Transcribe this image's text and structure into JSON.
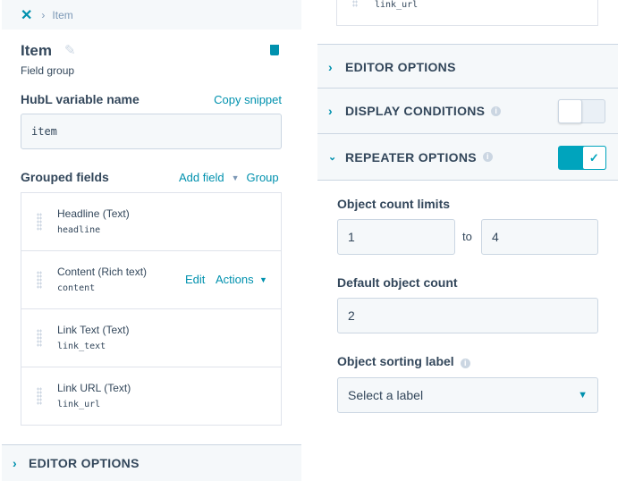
{
  "breadcrumb": {
    "current": "Item"
  },
  "header": {
    "title": "Item",
    "subtitle": "Field group"
  },
  "hubl": {
    "label": "HubL variable name",
    "copy": "Copy snippet",
    "value": "item"
  },
  "grouped": {
    "label": "Grouped fields",
    "add": "Add field",
    "group": "Group",
    "fields": [
      {
        "name": "Headline (Text)",
        "key": "headline"
      },
      {
        "name": "Content (Rich text)",
        "key": "content",
        "edit": "Edit",
        "actions": "Actions"
      },
      {
        "name": "Link Text (Text)",
        "key": "link_text"
      },
      {
        "name": "Link URL (Text)",
        "key": "link_url"
      }
    ]
  },
  "left_editor": "EDITOR OPTIONS",
  "right": {
    "top_key": "link_url",
    "editor": "EDITOR OPTIONS",
    "display": "DISPLAY CONDITIONS",
    "display_on": false,
    "repeater": "REPEATER OPTIONS",
    "repeater_on": true,
    "limits_label": "Object count limits",
    "min": "1",
    "to": "to",
    "max": "4",
    "default_label": "Default object count",
    "default": "2",
    "sort_label": "Object sorting label",
    "sort_value": "Select a label"
  },
  "colors": {
    "accent": "#0091ae",
    "text": "#33475b",
    "panel": "#f5f8fa"
  }
}
